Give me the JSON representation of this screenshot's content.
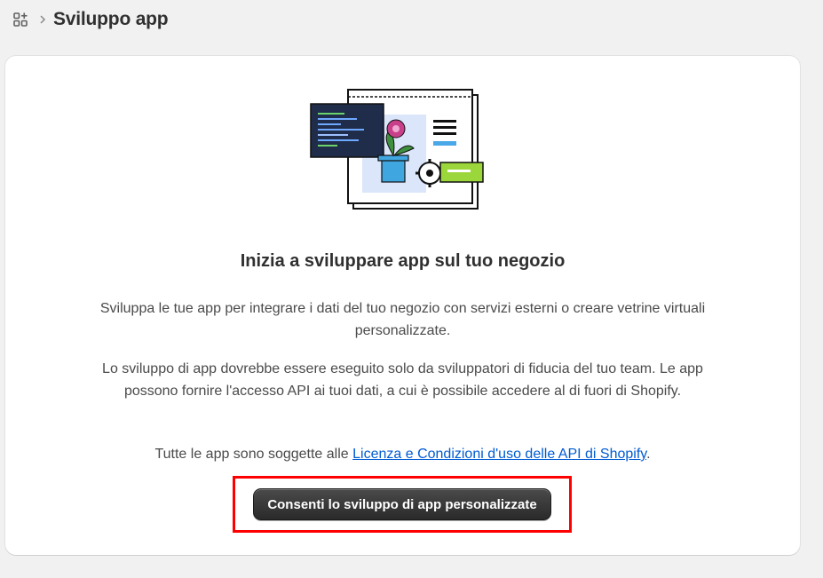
{
  "header": {
    "title": "Sviluppo app",
    "icon": "apps-grid-icon"
  },
  "card": {
    "heading": "Inizia a sviluppare app sul tuo negozio",
    "paragraph1": "Sviluppa le tue app per integrare i dati del tuo negozio con servizi esterni o creare vetrine virtuali personalizzate.",
    "paragraph2": "Lo sviluppo di app dovrebbe essere eseguito solo da sviluppatori di fiducia del tuo team. Le app possono fornire l'accesso API ai tuoi dati, a cui è possibile accedere al di fuori di Shopify.",
    "terms_prefix": "Tutte le app sono soggette alle ",
    "terms_link": "Licenza e Condizioni d'uso delle API di Shopify",
    "terms_suffix": ".",
    "button_label": "Consenti lo sviluppo di app personalizzate"
  },
  "colors": {
    "link": "#005bd3",
    "button_bg": "#303030",
    "highlight": "#ff0000"
  }
}
